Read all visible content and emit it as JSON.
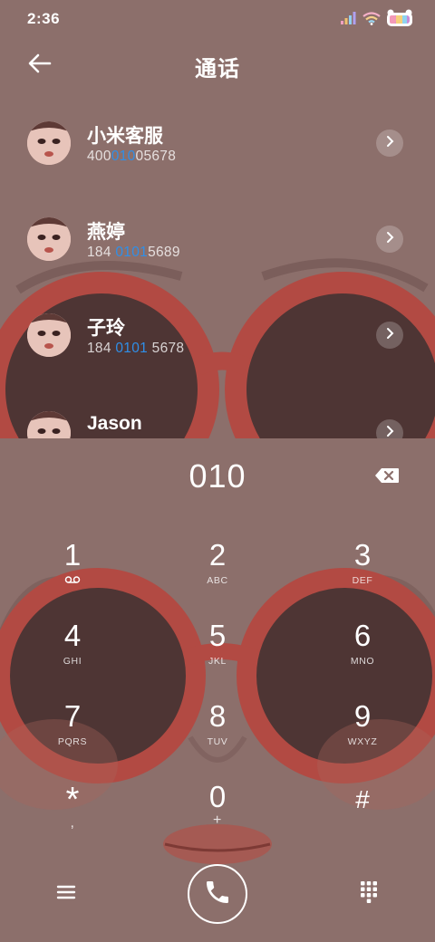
{
  "status_bar": {
    "time": "2:36",
    "icons": [
      "signal-icon",
      "wifi-icon",
      "battery-icon"
    ]
  },
  "header": {
    "back_icon": "arrow-left-icon",
    "title": "通话"
  },
  "contacts": [
    {
      "name": "小米客服",
      "number_pre": "400",
      "number_match": "010",
      "number_post": "05678"
    },
    {
      "name": "燕婷",
      "number_pre": "184 ",
      "number_match": "0101",
      "number_post": "5689"
    },
    {
      "name": "子玲",
      "number_pre": "184 ",
      "number_match": "0101",
      "number_post": " 5678"
    },
    {
      "name": "Jason",
      "number_pre": "",
      "number_match": "",
      "number_post": ""
    }
  ],
  "dialer": {
    "digits": "010",
    "backspace_icon": "backspace-icon"
  },
  "keypad": [
    {
      "digit": "1",
      "letters": "",
      "icon": "voicemail-icon"
    },
    {
      "digit": "2",
      "letters": "ABC"
    },
    {
      "digit": "3",
      "letters": "DEF"
    },
    {
      "digit": "4",
      "letters": "GHI"
    },
    {
      "digit": "5",
      "letters": "JKL"
    },
    {
      "digit": "6",
      "letters": "MNO"
    },
    {
      "digit": "7",
      "letters": "PQRS"
    },
    {
      "digit": "8",
      "letters": "TUV"
    },
    {
      "digit": "9",
      "letters": "WXYZ"
    },
    {
      "digit": "*",
      "letters": ","
    },
    {
      "digit": "0",
      "letters": "+"
    },
    {
      "digit": "#",
      "letters": ""
    }
  ],
  "bottom_bar": {
    "menu_icon": "menu-icon",
    "call_icon": "phone-icon",
    "keypad_icon": "dialpad-icon"
  },
  "colors": {
    "highlight": "#2f8fe8",
    "background": "#8c6f6b",
    "glasses_frame": "#b24a43",
    "lens": "#4e3534"
  }
}
